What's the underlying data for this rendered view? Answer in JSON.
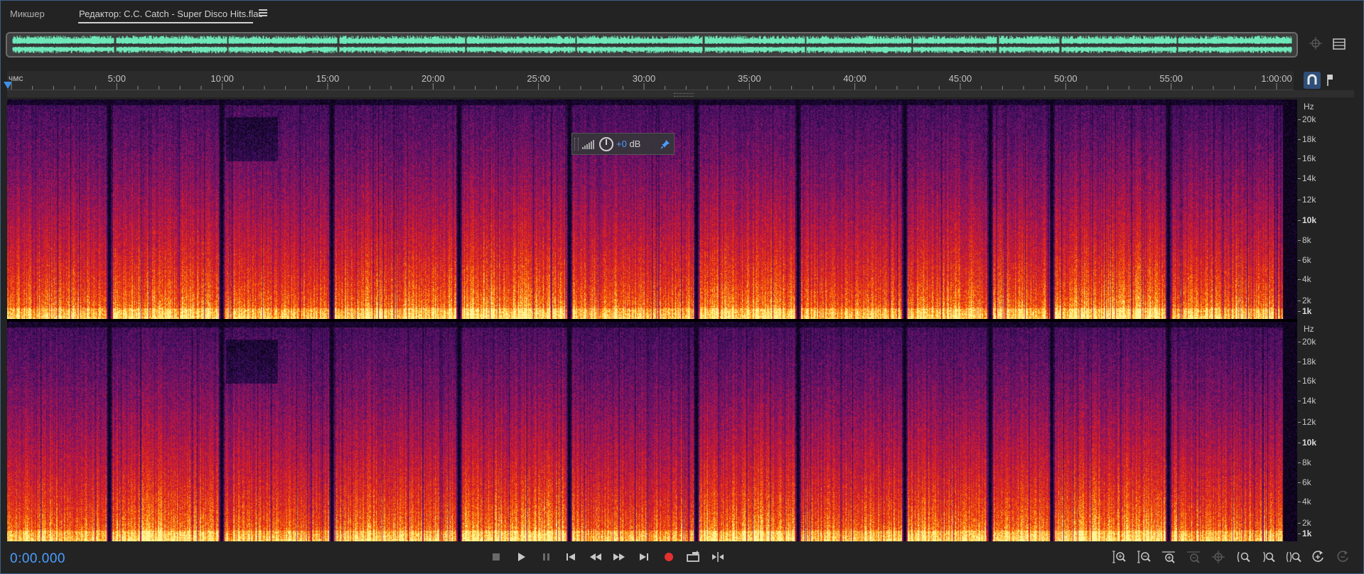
{
  "tabs": [
    {
      "label": "Микшер",
      "active": false
    },
    {
      "label": "Редактор: C.C. Catch - Super Disco Hits.flac",
      "active": true
    }
  ],
  "ruler": {
    "unit_label": "чмс",
    "labels": [
      "5:00",
      "10:00",
      "15:00",
      "20:00",
      "25:00",
      "30:00",
      "35:00",
      "40:00",
      "45:00",
      "50:00",
      "55:00",
      "1:00:00"
    ]
  },
  "spectral": {
    "hz_unit": "Hz",
    "labels": [
      {
        "text": "20k",
        "bold": false
      },
      {
        "text": "18k",
        "bold": false
      },
      {
        "text": "16k",
        "bold": false
      },
      {
        "text": "14k",
        "bold": false
      },
      {
        "text": "12k",
        "bold": false
      },
      {
        "text": "10k",
        "bold": true
      },
      {
        "text": "8k",
        "bold": false
      },
      {
        "text": "6k",
        "bold": false
      },
      {
        "text": "4k",
        "bold": false
      },
      {
        "text": "2k",
        "bold": false
      },
      {
        "text": "1k",
        "bold": true
      }
    ]
  },
  "track_breaks_minutes": [
    4.9,
    10.3,
    15.6,
    21.7,
    27.0,
    33.1,
    38.0,
    43.1,
    47.2,
    50.2,
    55.8
  ],
  "hud": {
    "value": "+0",
    "unit": "dB"
  },
  "transport": {
    "timecode": "0:00.000"
  },
  "colors": {
    "accent": "#4a9eff",
    "waveform": "#6ee8b8",
    "record": "#e53030"
  }
}
